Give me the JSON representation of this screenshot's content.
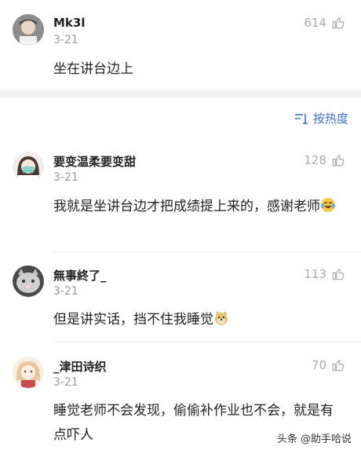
{
  "comments": [
    {
      "user": "Mk3l",
      "date": "3-21",
      "likes": "614",
      "text": "坐在讲台边上"
    },
    {
      "user": "要变温柔要变甜",
      "date": "3-21",
      "likes": "128",
      "text": "我就是坐讲台边才把成绩提上来的，感谢老师"
    },
    {
      "user": "無事終了_",
      "date": "3-21",
      "likes": "113",
      "text": "但是讲实话，挡不住我睡觉"
    },
    {
      "user": "_津田诗织",
      "date": "3-21",
      "likes": "70",
      "text": "睡觉老师不会发现，偷偷补作业也不会，就是有点吓人"
    }
  ],
  "sort": {
    "label": "按热度"
  },
  "watermark": "头条 @助手哈说",
  "icons": {
    "like": "thumb-up-icon",
    "sort": "sort-icon",
    "crying": "crying-laughing-emoji",
    "doge": "doge-emoji"
  }
}
